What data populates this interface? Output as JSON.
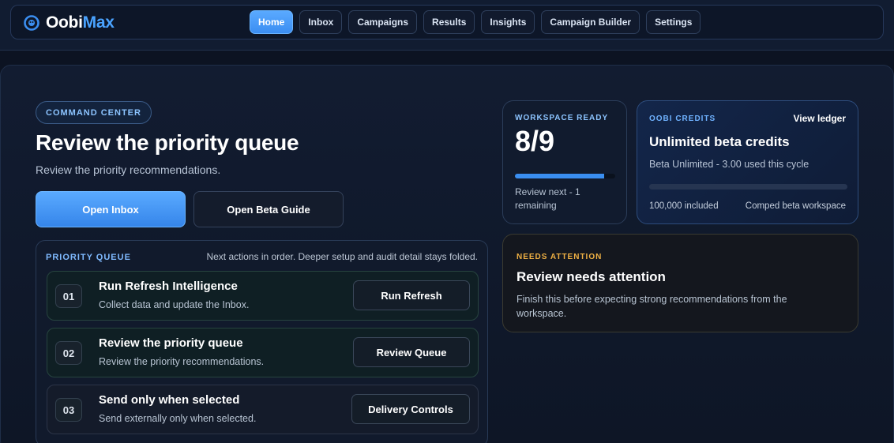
{
  "brand": {
    "name_part1": "Oobi",
    "name_part2": "Max",
    "logo_icon": "oobi-logo-icon"
  },
  "nav": {
    "tabs": [
      {
        "label": "Home",
        "active": true
      },
      {
        "label": "Inbox",
        "active": false
      },
      {
        "label": "Campaigns",
        "active": false
      },
      {
        "label": "Results",
        "active": false
      },
      {
        "label": "Insights",
        "active": false
      },
      {
        "label": "Campaign Builder",
        "active": false
      },
      {
        "label": "Settings",
        "active": false
      }
    ]
  },
  "hero": {
    "pill": "COMMAND CENTER",
    "title": "Review the priority queue",
    "subtitle": "Review the priority recommendations.",
    "primary_button": "Open Inbox",
    "secondary_button": "Open Beta Guide"
  },
  "queue": {
    "label": "PRIORITY QUEUE",
    "note": "Next actions in order. Deeper setup and audit detail stays folded.",
    "items": [
      {
        "num": "01",
        "title": "Run Refresh Intelligence",
        "desc": "Collect data and update the Inbox.",
        "button": "Run Refresh"
      },
      {
        "num": "02",
        "title": "Review the priority queue",
        "desc": "Review the priority recommendations.",
        "button": "Review Queue"
      },
      {
        "num": "03",
        "title": "Send only when selected",
        "desc": "Send externally only when selected.",
        "button": "Delivery Controls"
      }
    ]
  },
  "workspace": {
    "kicker": "WORKSPACE READY",
    "value": "8/9",
    "progress": 0.889,
    "note": "Review next - 1 remaining"
  },
  "credits": {
    "kicker": "OOBI CREDITS",
    "ledger_link": "View ledger",
    "title": "Unlimited beta credits",
    "subtitle": "Beta Unlimited - 3.00 used this cycle",
    "progress": 0.0,
    "included": "100,000 included",
    "workspace_type": "Comped beta workspace"
  },
  "attention": {
    "kicker": "NEEDS ATTENTION",
    "title": "Review needs attention",
    "desc": "Finish this before expecting strong recommendations from the workspace."
  },
  "colors": {
    "accent": "#4aa3ff",
    "background": "#0c1322",
    "warning": "#f0b144"
  }
}
